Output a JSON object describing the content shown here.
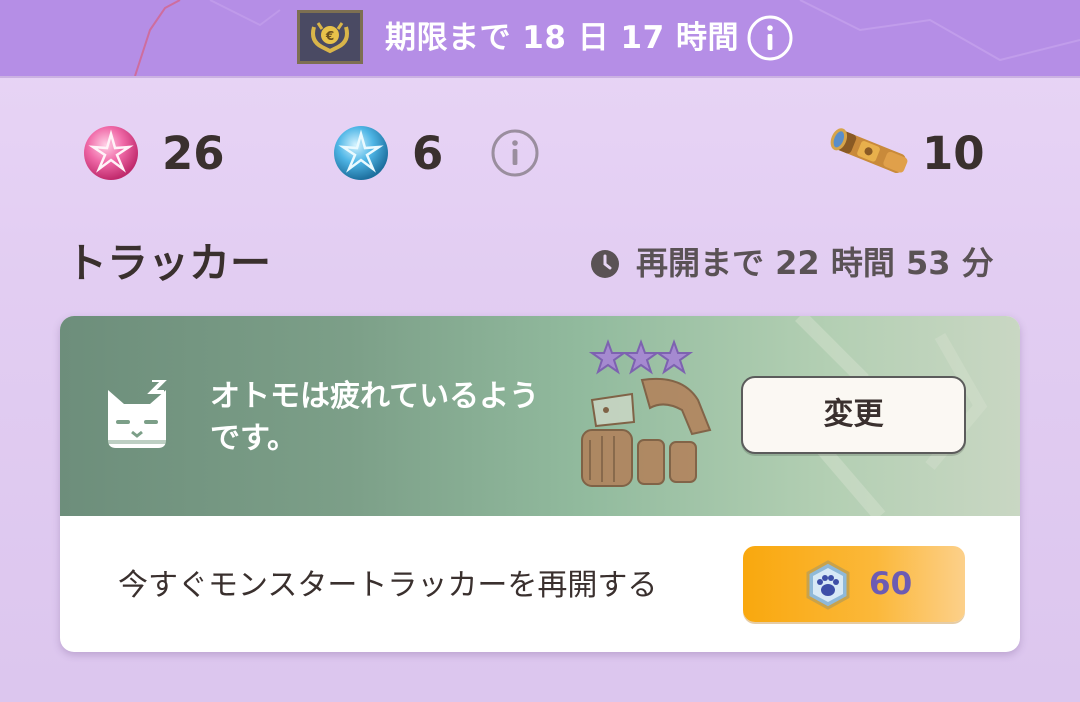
{
  "banner": {
    "deadline_text": "期限まで 18 日 17 時間",
    "emblem_icon": "crest-badge-icon",
    "info_icon": "info-icon"
  },
  "resources": [
    {
      "icon": "pink-gem-icon",
      "value": "26",
      "color": "#e94a8f"
    },
    {
      "icon": "blue-gem-icon",
      "value": "6",
      "color": "#3aa7d9"
    },
    {
      "icon": "telescope-icon",
      "value": "10"
    }
  ],
  "tracker": {
    "title": "トラッカー",
    "restart_time": "再開まで 22 時間 53 分"
  },
  "card": {
    "status_text": "オトモは疲れているようです。",
    "change_label": "変更",
    "restart_now_label": "今すぐモンスタートラッカーを再開する",
    "price": "60",
    "star_count": 3
  },
  "colors": {
    "banner": "#b58ee6",
    "background": "#e2cdf2",
    "card_green": "#7c9f88",
    "price_button": "#f9a80e",
    "price_text": "#6d5bb3"
  }
}
